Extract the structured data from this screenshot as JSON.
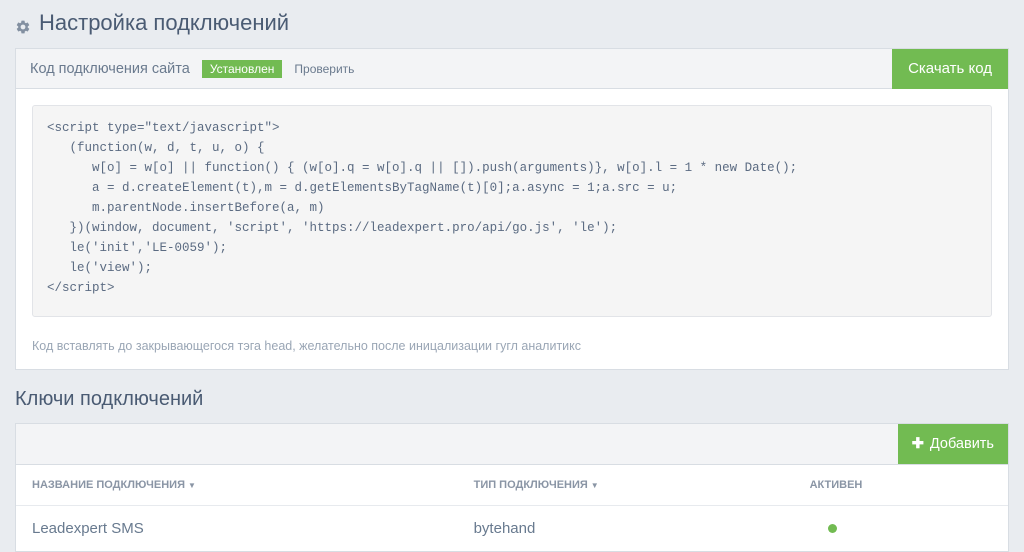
{
  "page": {
    "title": "Настройка подключений"
  },
  "code_panel": {
    "header_title": "Код подключения сайта",
    "status_badge": "Установлен",
    "check_link": "Проверить",
    "download_button": "Скачать код",
    "code": "<script type=\"text/javascript\">\n   (function(w, d, t, u, o) {\n      w[o] = w[o] || function() { (w[o].q = w[o].q || []).push(arguments)}, w[o].l = 1 * new Date();\n      a = d.createElement(t),m = d.getElementsByTagName(t)[0];a.async = 1;a.src = u;\n      m.parentNode.insertBefore(a, m)\n   })(window, document, 'script', 'https://leadexpert.pro/api/go.js', 'le');\n   le('init','LE-0059');\n   le('view');\n</script>",
    "note": "Код вставлять до закрывающегося тэга head, желательно после иницализации гугл аналитикс"
  },
  "keys_section": {
    "title": "Ключи подключений",
    "add_button": "Добавить",
    "columns": {
      "name": "НАЗВАНИЕ ПОДКЛЮЧЕНИЯ",
      "type": "ТИП ПОДКЛЮЧЕНИЯ",
      "active": "АКТИВЕН"
    },
    "rows": [
      {
        "name": "Leadexpert SMS",
        "type": "bytehand",
        "active": true
      }
    ]
  }
}
